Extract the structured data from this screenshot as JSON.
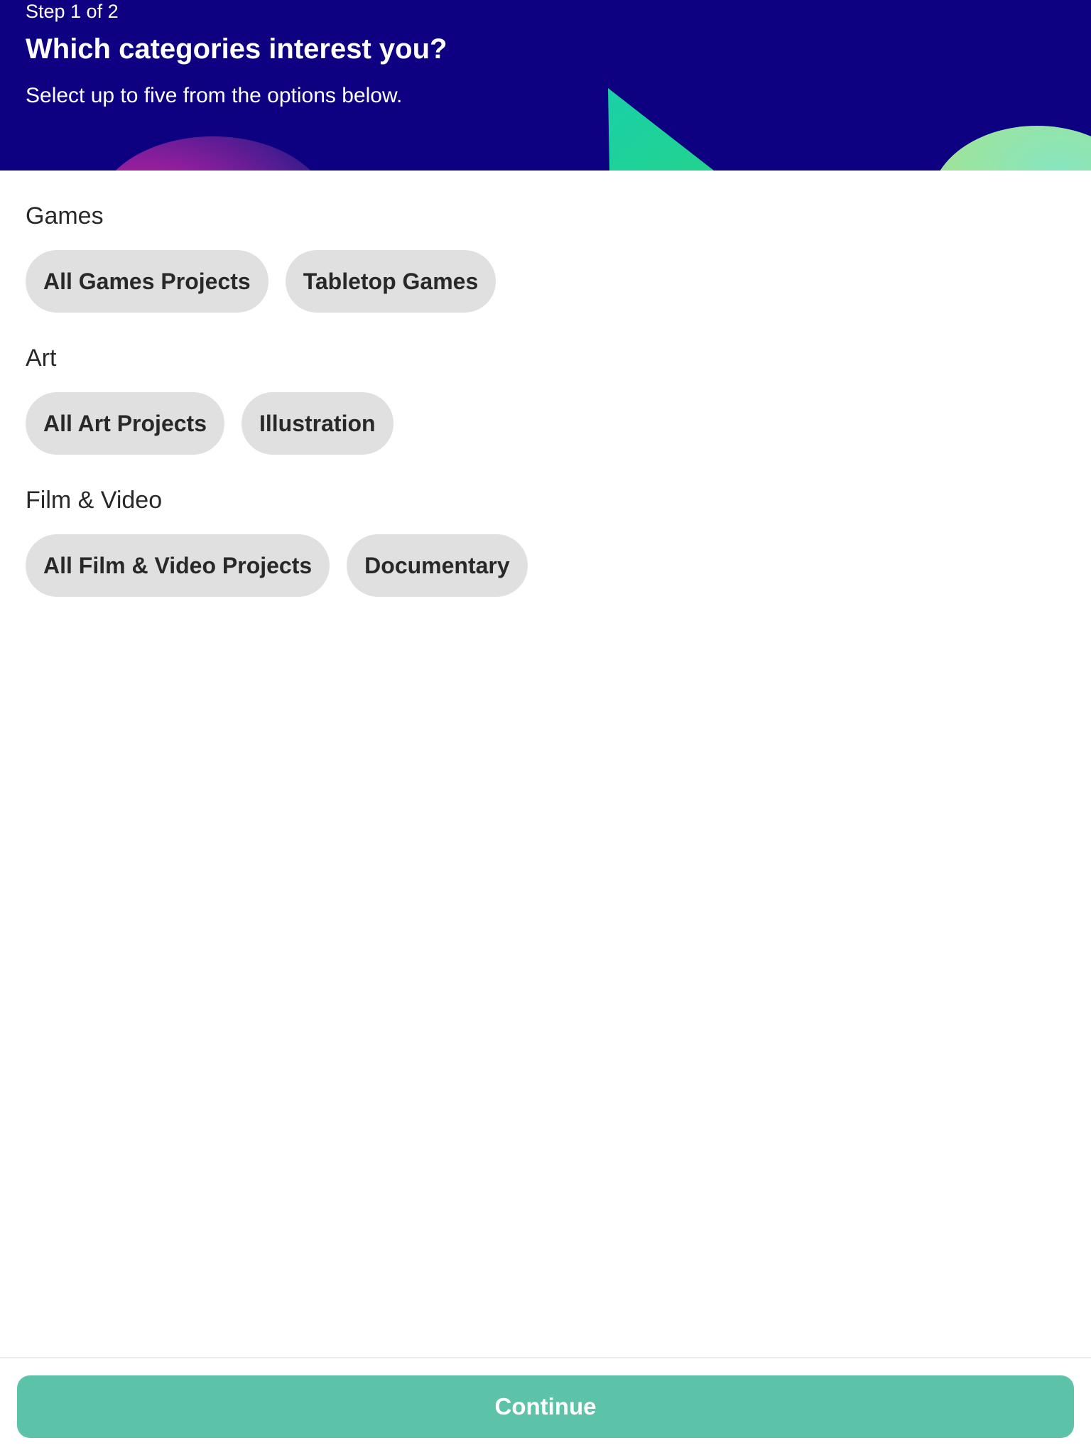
{
  "header": {
    "step": "Step 1 of 2",
    "title": "Which categories interest you?",
    "subtitle": "Select up to five from the options below."
  },
  "sections": [
    {
      "title": "Games",
      "chips": [
        "All Games Projects",
        "Tabletop Games"
      ]
    },
    {
      "title": "Art",
      "chips": [
        "All Art Projects",
        "Illustration"
      ]
    },
    {
      "title": "Film & Video",
      "chips": [
        "All Film & Video Projects",
        "Documentary"
      ]
    }
  ],
  "footer": {
    "continue_label": "Continue"
  },
  "colors": {
    "header_bg": "#0d0081",
    "chip_bg": "#dfe0df",
    "continue_bg": "#5dc3a8",
    "accent_pink": "#e0207a",
    "accent_green": "#1fd3a0"
  }
}
